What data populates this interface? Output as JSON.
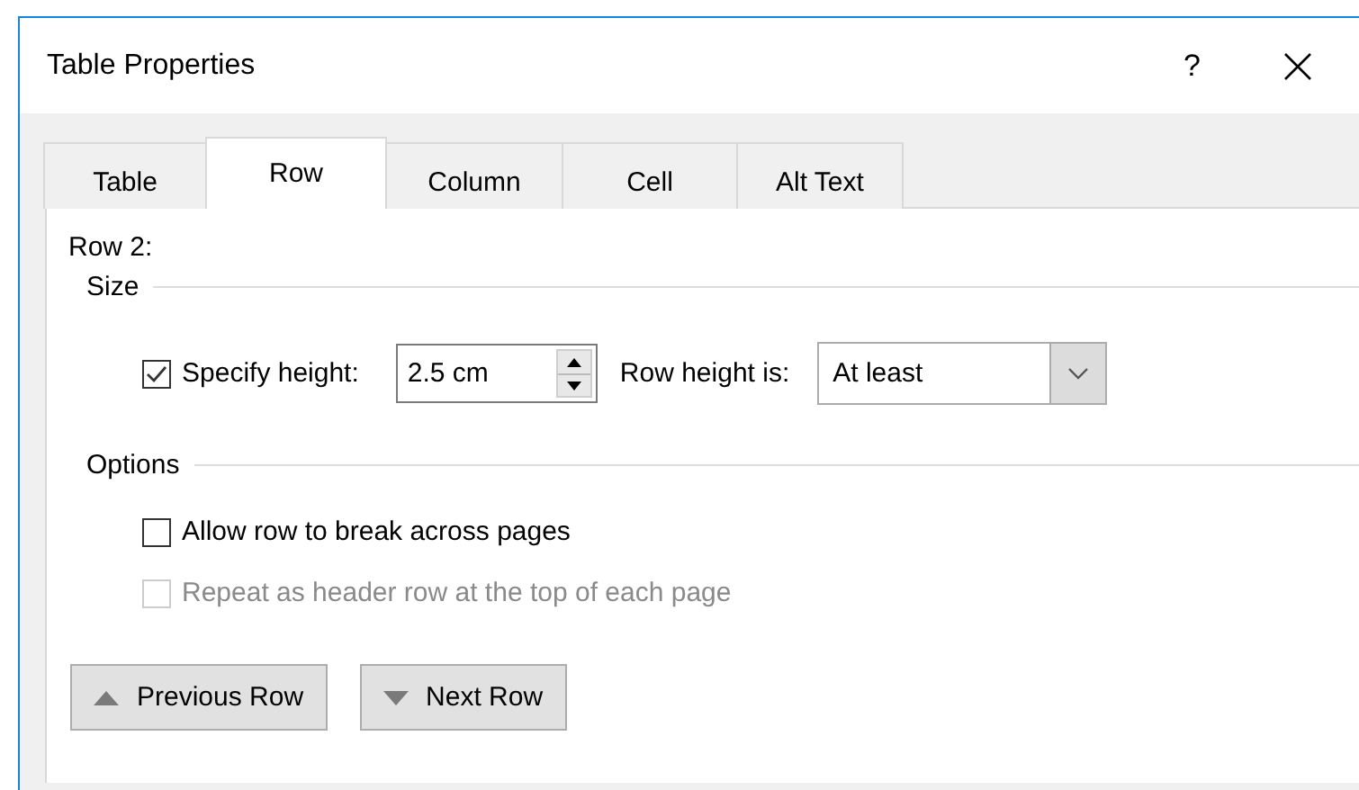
{
  "window": {
    "title": "Table Properties",
    "help": "?"
  },
  "tabs": [
    {
      "label": "Table",
      "selected": false
    },
    {
      "label": "Row",
      "selected": true
    },
    {
      "label": "Column",
      "selected": false
    },
    {
      "label": "Cell",
      "selected": false
    },
    {
      "label": "Alt Text",
      "selected": false
    }
  ],
  "row_label": "Row 2:",
  "size": {
    "title": "Size",
    "specify_height": {
      "label": "Specify height:",
      "checked": true
    },
    "height_field": {
      "value": "2.5 cm"
    },
    "row_height_is": {
      "label": "Row height is:"
    },
    "dropdown": {
      "value": "At least"
    }
  },
  "options": {
    "title": "Options",
    "checkboxes": [
      {
        "label": "Allow row to break across pages",
        "checked": false,
        "disabled": false
      },
      {
        "label": "Repeat as header row at the top of each page",
        "checked": false,
        "disabled": true
      }
    ]
  },
  "buttons": [
    {
      "label": "Previous Row",
      "kind": "up"
    },
    {
      "label": "Next Row",
      "kind": "down"
    }
  ]
}
